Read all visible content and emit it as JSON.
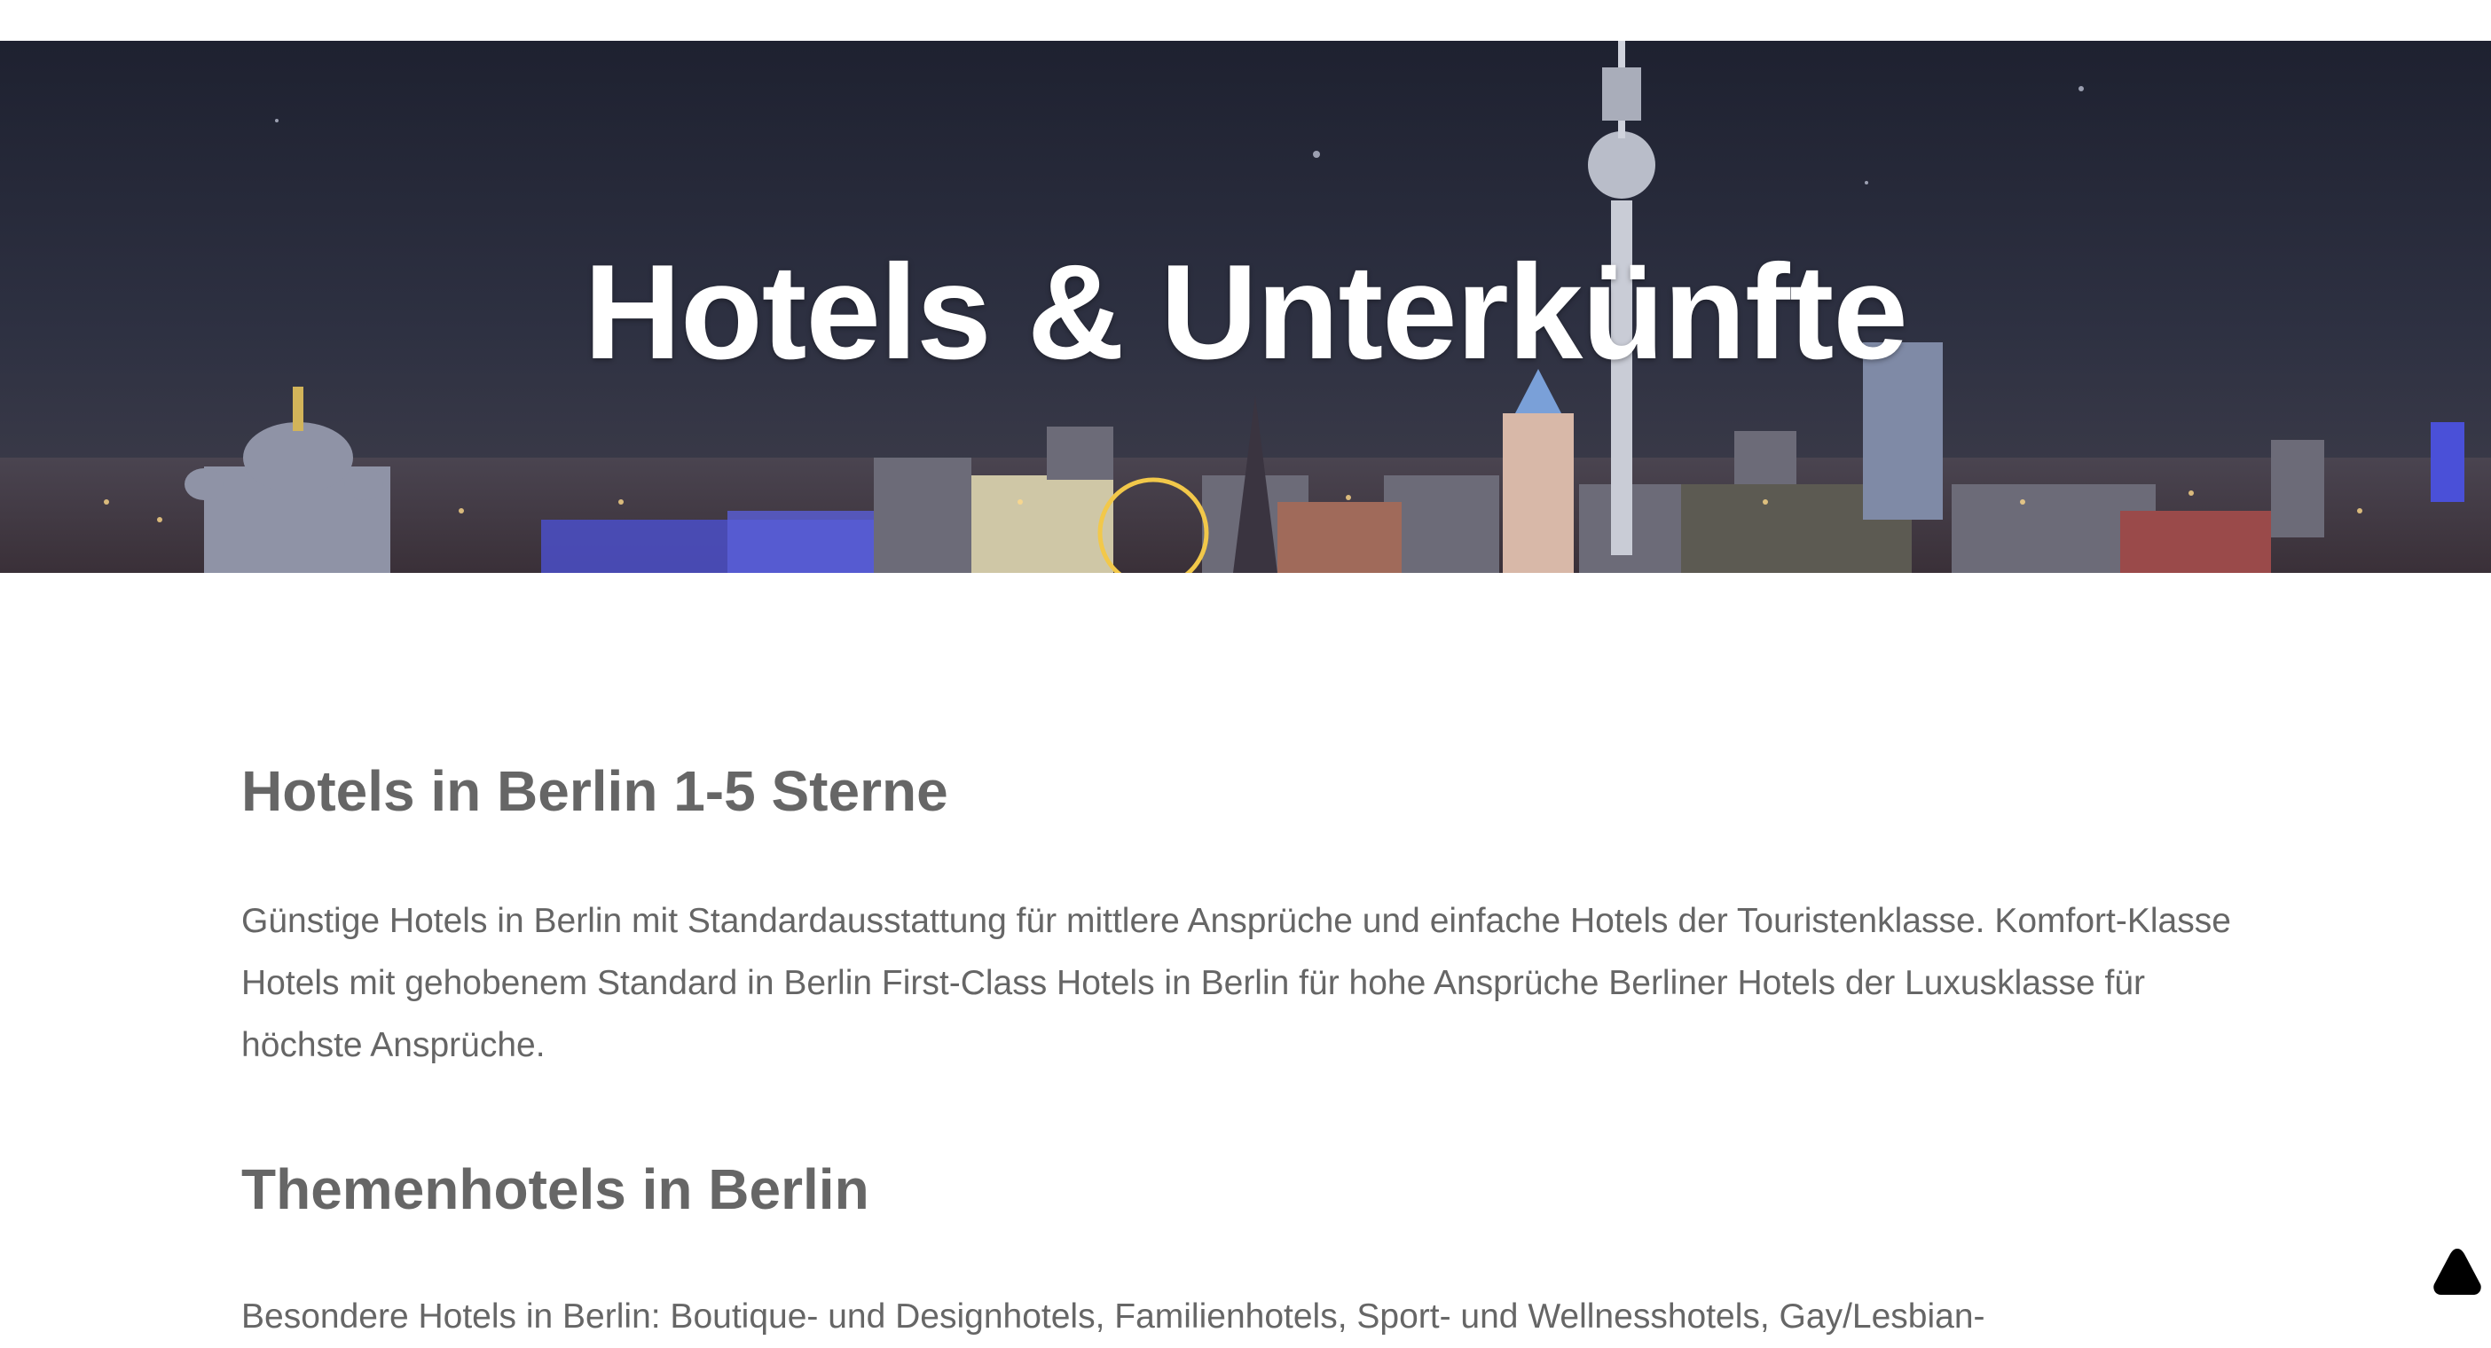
{
  "hero": {
    "title": "Hotels & Unterkünfte"
  },
  "sections": [
    {
      "heading": "Hotels in Berlin 1-5 Sterne",
      "text": "Günstige Hotels in Berlin mit Standardausstattung für mittlere Ansprüche und einfache Hotels der Touristenklasse. Komfort-Klasse Hotels mit gehobenem Standard in Berlin First-Class Hotels in Berlin für hohe Ansprüche Berliner Hotels der Luxusklasse für höchste Ansprüche."
    },
    {
      "heading": "Themenhotels in Berlin",
      "text": "Besondere Hotels in Berlin: Boutique- und Designhotels, Familienhotels, Sport- und Wellnesshotels, Gay/Lesbian-"
    }
  ],
  "scroll_top": {
    "icon": "triangle-up-icon"
  },
  "colors": {
    "text": "#666666",
    "hero_title": "#ffffff",
    "hero_sky": "#2a2d3f"
  }
}
